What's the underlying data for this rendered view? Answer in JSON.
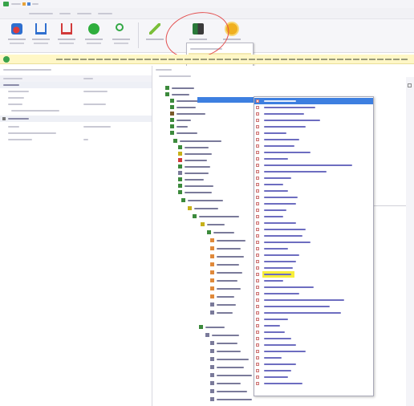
{
  "colors": {
    "accent": "#3d7fe0",
    "highlight": "#f7ee3a",
    "info_bg": "#fff7c6",
    "annotation": "#e35050",
    "menu_text": "#6d6dc0"
  },
  "icons": {
    "app": "app-logo-icon",
    "info": "info-icon",
    "ribbon": [
      "red-dot-tool-icon",
      "upload-icon",
      "download-red-icon",
      "green-play-icon",
      "search-icon",
      "magic-wand-icon",
      "tree-add-icon",
      "star-settings-icon"
    ]
  },
  "left_panel_sections": 2,
  "submenu_item_count": 45,
  "submenu_selected_index": 0,
  "submenu_highlighted_index": 27
}
